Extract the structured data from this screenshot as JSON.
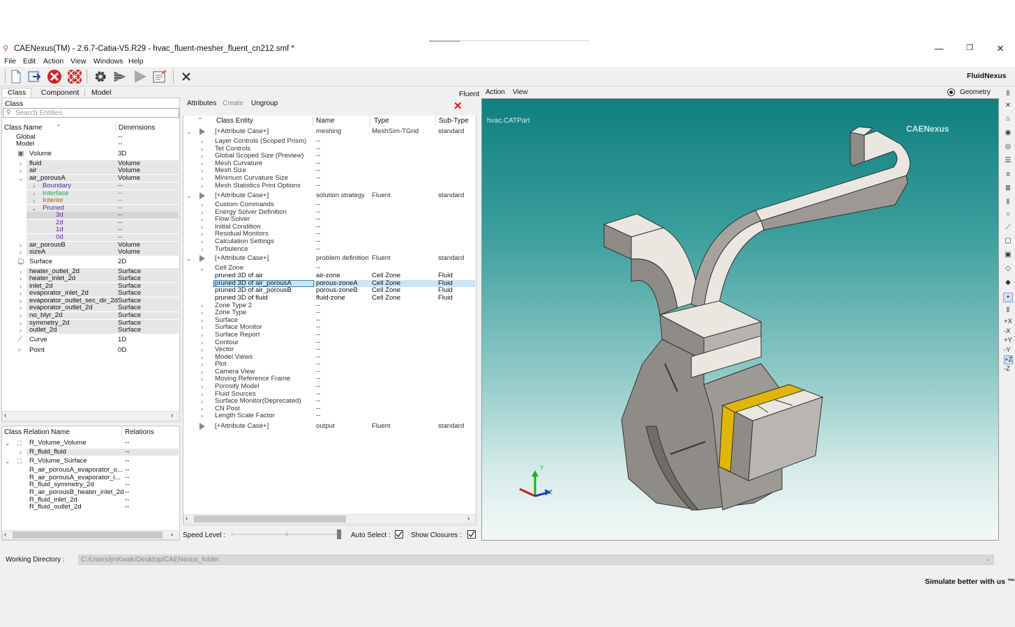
{
  "window": {
    "title": "CAENexus(TM) - 2.6.7-Catia-V5.R29 - hvac_fluent-mesher_fluent_cn212.smf  *",
    "minimize": "—",
    "restore": "❐",
    "close": "✕"
  },
  "menu": [
    "File",
    "Edit",
    "Action",
    "View",
    "Windows",
    "Help"
  ],
  "toolbar": {
    "icons": [
      "new-document-icon",
      "open-file-icon",
      "stop-icon",
      "stop-all-icon",
      "settings-gear-icon",
      "run-icon",
      "play-icon",
      "report-icon",
      "close-cross-icon"
    ],
    "brand": "FluidNexus"
  },
  "left": {
    "tabs": [
      "Class",
      "Component",
      "Model"
    ],
    "class_label": "Class",
    "search_placeholder": "Search Entities",
    "col_name": "Class Name",
    "col_dim": "Dimensions",
    "rows": [
      {
        "name": "Global",
        "dim": "--"
      },
      {
        "name": "Model",
        "dim": "--"
      },
      {
        "name": "Volume",
        "dim": "3D"
      },
      {
        "name": "fluid",
        "dim": "Volume"
      },
      {
        "name": "air",
        "dim": "Volume"
      },
      {
        "name": "air_porousA",
        "dim": "Volume"
      },
      {
        "name": "Boundary",
        "dim": "--"
      },
      {
        "name": "Interface",
        "dim": "--"
      },
      {
        "name": "Interior",
        "dim": "--"
      },
      {
        "name": "Pruned",
        "dim": "--"
      },
      {
        "name": "3d",
        "dim": "--"
      },
      {
        "name": "2d",
        "dim": "--"
      },
      {
        "name": "1d",
        "dim": "--"
      },
      {
        "name": "0d",
        "dim": "--"
      },
      {
        "name": "air_porousB",
        "dim": "Volume"
      },
      {
        "name": "sizeA",
        "dim": "Volume"
      },
      {
        "name": "Surface",
        "dim": "2D"
      },
      {
        "name": "heater_outlet_2d",
        "dim": "Surface"
      },
      {
        "name": "heater_inlet_2d",
        "dim": "Surface"
      },
      {
        "name": "inlet_2d",
        "dim": "Surface"
      },
      {
        "name": "evaporator_inlet_2d",
        "dim": "Surface"
      },
      {
        "name": "evaporator_outlet_sec_dir_2d",
        "dim": "Surface"
      },
      {
        "name": "evaporator_outlet_2d",
        "dim": "Surface"
      },
      {
        "name": "no_blyr_2d",
        "dim": "Surface"
      },
      {
        "name": "symmetry_2d",
        "dim": "Surface"
      },
      {
        "name": "outlet_2d",
        "dim": "Surface"
      },
      {
        "name": "Curve",
        "dim": "1D"
      },
      {
        "name": "Point",
        "dim": "0D"
      }
    ],
    "rel_col_name": "Class Relation Name",
    "rel_col_rel": "Relations",
    "relations": [
      {
        "name": "R_Volume_Volume",
        "rel": "--"
      },
      {
        "name": "R_fluid_fluid",
        "rel": "--"
      },
      {
        "name": "R_Volume_Surface",
        "rel": "--"
      },
      {
        "name": "R_air_porousA_evaporator_o...",
        "rel": "--"
      },
      {
        "name": "R_air_porousA_evaporator_i...",
        "rel": "--"
      },
      {
        "name": "R_fluid_symmetry_2d",
        "rel": "--"
      },
      {
        "name": "R_air_porousB_heater_inlet_2d",
        "rel": "--"
      },
      {
        "name": "R_fluid_inlet_2d",
        "rel": "--"
      },
      {
        "name": "R_fluid_outlet_2d",
        "rel": "--"
      }
    ]
  },
  "middle": {
    "fluent_tab": "Fluent",
    "tabs": [
      "Attributes",
      "Create",
      "Ungroup"
    ],
    "close_icon": "✕",
    "cols": [
      "Class Entity",
      "Name",
      "Type",
      "Sub-Type"
    ],
    "rows": [
      {
        "entity": "[+Attribute Case+]",
        "name": "meshing",
        "type": "MeshSim-TGrid",
        "sub": "standard"
      },
      {
        "entity": "Layer Controls (Scoped Prism)",
        "name": "--",
        "type": "",
        "sub": ""
      },
      {
        "entity": "Tet Controls",
        "name": "--",
        "type": "",
        "sub": ""
      },
      {
        "entity": "Global Scoped Size (Preview)",
        "name": "--",
        "type": "",
        "sub": ""
      },
      {
        "entity": "Mesh Curvature",
        "name": "--",
        "type": "",
        "sub": ""
      },
      {
        "entity": "Mesh Size",
        "name": "--",
        "type": "",
        "sub": ""
      },
      {
        "entity": "Minimum Curvature Size",
        "name": "--",
        "type": "",
        "sub": ""
      },
      {
        "entity": "Mesh Statistics Print Options",
        "name": "--",
        "type": "",
        "sub": ""
      },
      {
        "entity": "[+Attribute Case+]",
        "name": "solution strategy",
        "type": "Fluent",
        "sub": "standard"
      },
      {
        "entity": "Custom Commands",
        "name": "--",
        "type": "",
        "sub": ""
      },
      {
        "entity": "Energy Solver Definition",
        "name": "--",
        "type": "",
        "sub": ""
      },
      {
        "entity": "Flow Solver",
        "name": "--",
        "type": "",
        "sub": ""
      },
      {
        "entity": "Initial Condition",
        "name": "--",
        "type": "",
        "sub": ""
      },
      {
        "entity": "Residual Monitors",
        "name": "--",
        "type": "",
        "sub": ""
      },
      {
        "entity": "Calculation Settings",
        "name": "--",
        "type": "",
        "sub": ""
      },
      {
        "entity": "Turbulence",
        "name": "--",
        "type": "",
        "sub": ""
      },
      {
        "entity": "[+Attribute Case+]",
        "name": "problem definition",
        "type": "Fluent",
        "sub": "standard"
      },
      {
        "entity": "Cell Zone",
        "name": "--",
        "type": "",
        "sub": ""
      },
      {
        "entity": "pruned 3D of air",
        "name": "air-zone",
        "type": "Cell Zone",
        "sub": "Fluid"
      },
      {
        "entity": "pruned 3D of air_porousA",
        "name": "porous-zoneA",
        "type": "Cell Zone",
        "sub": "Fluid"
      },
      {
        "entity": "pruned 3D of air_porousB",
        "name": "porous-zoneB",
        "type": "Cell Zone",
        "sub": "Fluid"
      },
      {
        "entity": "pruned 3D of fluid",
        "name": "fluid-zone",
        "type": "Cell Zone",
        "sub": "Fluid"
      },
      {
        "entity": "Zone Type 2",
        "name": "--",
        "type": "",
        "sub": ""
      },
      {
        "entity": "Zone Type",
        "name": "--",
        "type": "",
        "sub": ""
      },
      {
        "entity": "Surface",
        "name": "--",
        "type": "",
        "sub": ""
      },
      {
        "entity": "Surface Monitor",
        "name": "--",
        "type": "",
        "sub": ""
      },
      {
        "entity": "Surface Report",
        "name": "--",
        "type": "",
        "sub": ""
      },
      {
        "entity": "Contour",
        "name": "--",
        "type": "",
        "sub": ""
      },
      {
        "entity": "Vector",
        "name": "--",
        "type": "",
        "sub": ""
      },
      {
        "entity": "Model Views",
        "name": "--",
        "type": "",
        "sub": ""
      },
      {
        "entity": "Plot",
        "name": "--",
        "type": "",
        "sub": ""
      },
      {
        "entity": "Camera View",
        "name": "--",
        "type": "",
        "sub": ""
      },
      {
        "entity": "Moving Reference Frame",
        "name": "--",
        "type": "",
        "sub": ""
      },
      {
        "entity": "Porosity Model",
        "name": "--",
        "type": "",
        "sub": ""
      },
      {
        "entity": "Fluid Sources",
        "name": "--",
        "type": "",
        "sub": ""
      },
      {
        "entity": "Surface Monitor(Deprecated)",
        "name": "--",
        "type": "",
        "sub": ""
      },
      {
        "entity": "CN Post",
        "name": "--",
        "type": "",
        "sub": ""
      },
      {
        "entity": "Length Scale Factor",
        "name": "--",
        "type": "",
        "sub": ""
      },
      {
        "entity": "[+Attribute Case+]",
        "name": "output",
        "type": "Fluent",
        "sub": "standard"
      }
    ],
    "speed_label": "Speed Level :",
    "auto_select": "Auto Select :",
    "show_closures": "Show Closures :"
  },
  "viewport": {
    "menu": [
      "Action",
      "View"
    ],
    "geometry_radio": "Geometry",
    "file": "hvac.CATPart",
    "brand": "CAENexus",
    "axis_y": "Y",
    "axis_z": "Z",
    "axis_labels": [
      "+X",
      "-X",
      "+Y",
      "-Y",
      "+Z",
      "-Z"
    ],
    "colors": {
      "top": "#0f7f7f",
      "bottom": "#f3f9f8",
      "part": "#b8b6b3",
      "highlight": "#e0b800"
    }
  },
  "footer": {
    "workdir_label": "Working Directory :",
    "workdir_value": "C:/Users/jmKwak/Desktop/CAENexus_folder",
    "slogan": "Simulate better with us ™"
  }
}
